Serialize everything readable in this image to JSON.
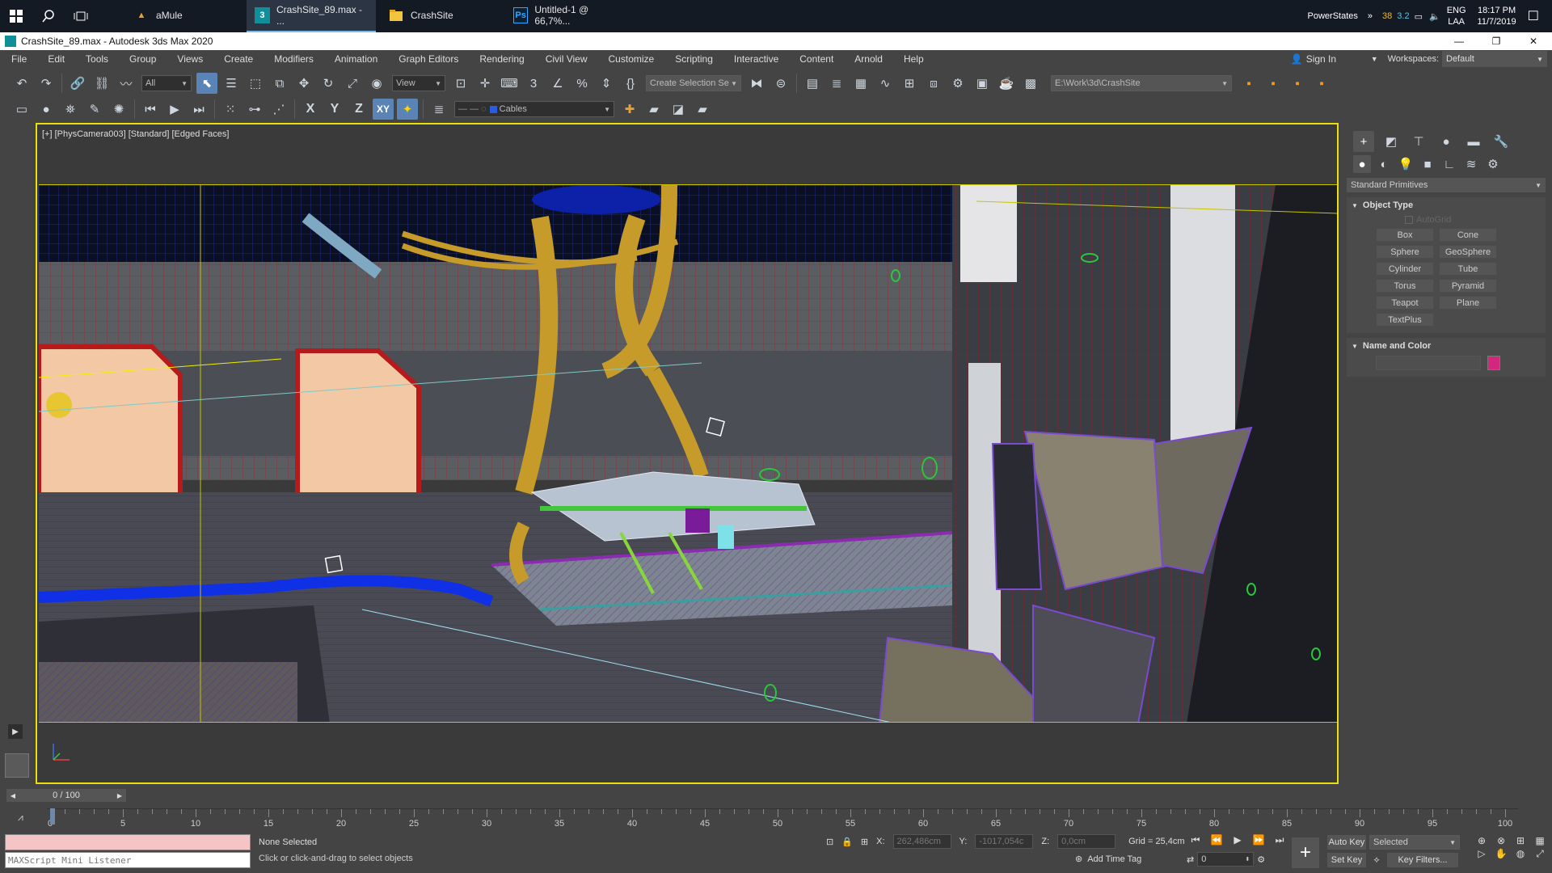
{
  "taskbar": {
    "apps": [
      {
        "label": "aMule",
        "active": false
      },
      {
        "label": "CrashSite_89.max - ...",
        "active": true
      },
      {
        "label": "CrashSite",
        "active": false
      },
      {
        "label": "Untitled-1 @ 66,7%...",
        "active": false
      }
    ],
    "tray": {
      "powerstates": "PowerStates",
      "temp1": "38",
      "temp2": "3.2",
      "lang1": "ENG",
      "lang2": "LAA",
      "time": "18:17 PM",
      "date": "11/7/2019"
    }
  },
  "window": {
    "title": "CrashSite_89.max - Autodesk 3ds Max 2020"
  },
  "menu": [
    "File",
    "Edit",
    "Tools",
    "Group",
    "Views",
    "Create",
    "Modifiers",
    "Animation",
    "Graph Editors",
    "Rendering",
    "Civil View",
    "Customize",
    "Scripting",
    "Interactive",
    "Content",
    "Arnold",
    "Help"
  ],
  "account": {
    "sign_in": "Sign In",
    "workspaces_label": "Workspaces:",
    "workspace": "Default"
  },
  "toolbar": {
    "filter": "All",
    "ref_coord": "View",
    "selection_set": "Create Selection Se",
    "project_path": "E:\\Work\\3d\\CrashSite",
    "axis_x": "X",
    "axis_y": "Y",
    "axis_z": "Z",
    "axis_xy": "XY",
    "layer": "Cables"
  },
  "viewport": {
    "label": "[+] [PhysCamera003] [Standard] [Edged Faces]"
  },
  "command_panel": {
    "category": "Standard Primitives",
    "object_type_title": "Object Type",
    "autogrid": "AutoGrid",
    "primitives": [
      "Box",
      "Cone",
      "Sphere",
      "GeoSphere",
      "Cylinder",
      "Tube",
      "Torus",
      "Pyramid",
      "Teapot",
      "Plane",
      "TextPlus"
    ],
    "name_color_title": "Name and Color",
    "object_color": "#d4267d"
  },
  "timeline": {
    "frame_display": "0 / 100",
    "ticks": [
      "0",
      "5",
      "10",
      "15",
      "20",
      "25",
      "30",
      "35",
      "40",
      "45",
      "50",
      "55",
      "60",
      "65",
      "70",
      "75",
      "80",
      "85",
      "90",
      "95",
      "100"
    ]
  },
  "status": {
    "listener": "MAXScript Mini Listener",
    "selection": "None Selected",
    "prompt": "Click or click-and-drag to select objects",
    "x_label": "X:",
    "x_value": "262,486cm",
    "y_label": "Y:",
    "y_value": "-1017,054c",
    "z_label": "Z:",
    "z_value": "0,0cm",
    "grid": "Grid = 25,4cm",
    "add_time_tag": "Add Time Tag",
    "auto_key": "Auto Key",
    "key_mode": "Selected",
    "set_key": "Set Key",
    "key_filters": "Key Filters...",
    "current_frame": "0"
  }
}
